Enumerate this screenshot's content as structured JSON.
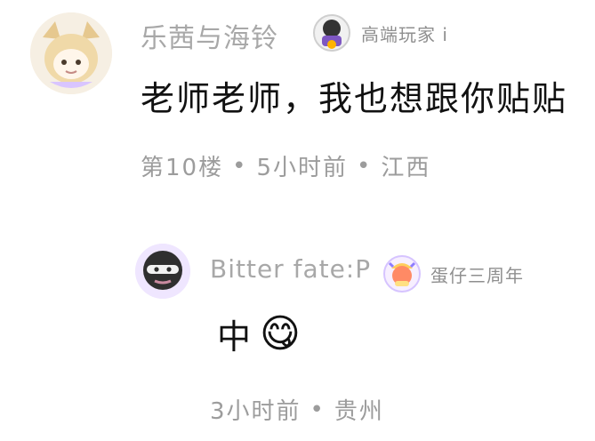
{
  "comment": {
    "username": "乐茜与海铃",
    "badge_label": "高端玩家 i",
    "text": "老师老师，我也想跟你贴贴",
    "floor": "第10楼",
    "time": "5小时前",
    "location": "江西"
  },
  "reply": {
    "username": "Bitter fate:P",
    "badge_label": "蛋仔三周年",
    "text": "中",
    "emoji": "😋",
    "time": "3小时前",
    "location": "贵州"
  },
  "colors": {
    "username": "#a8a8a8",
    "meta": "#9c9c9c",
    "content": "#111111"
  },
  "icons": {
    "avatar_main": "cat-hood-avatar",
    "avatar_reply": "ninja-avatar",
    "badge_main": "high-end-player-badge-icon",
    "badge_reply": "eggy-anniversary-badge-icon"
  }
}
